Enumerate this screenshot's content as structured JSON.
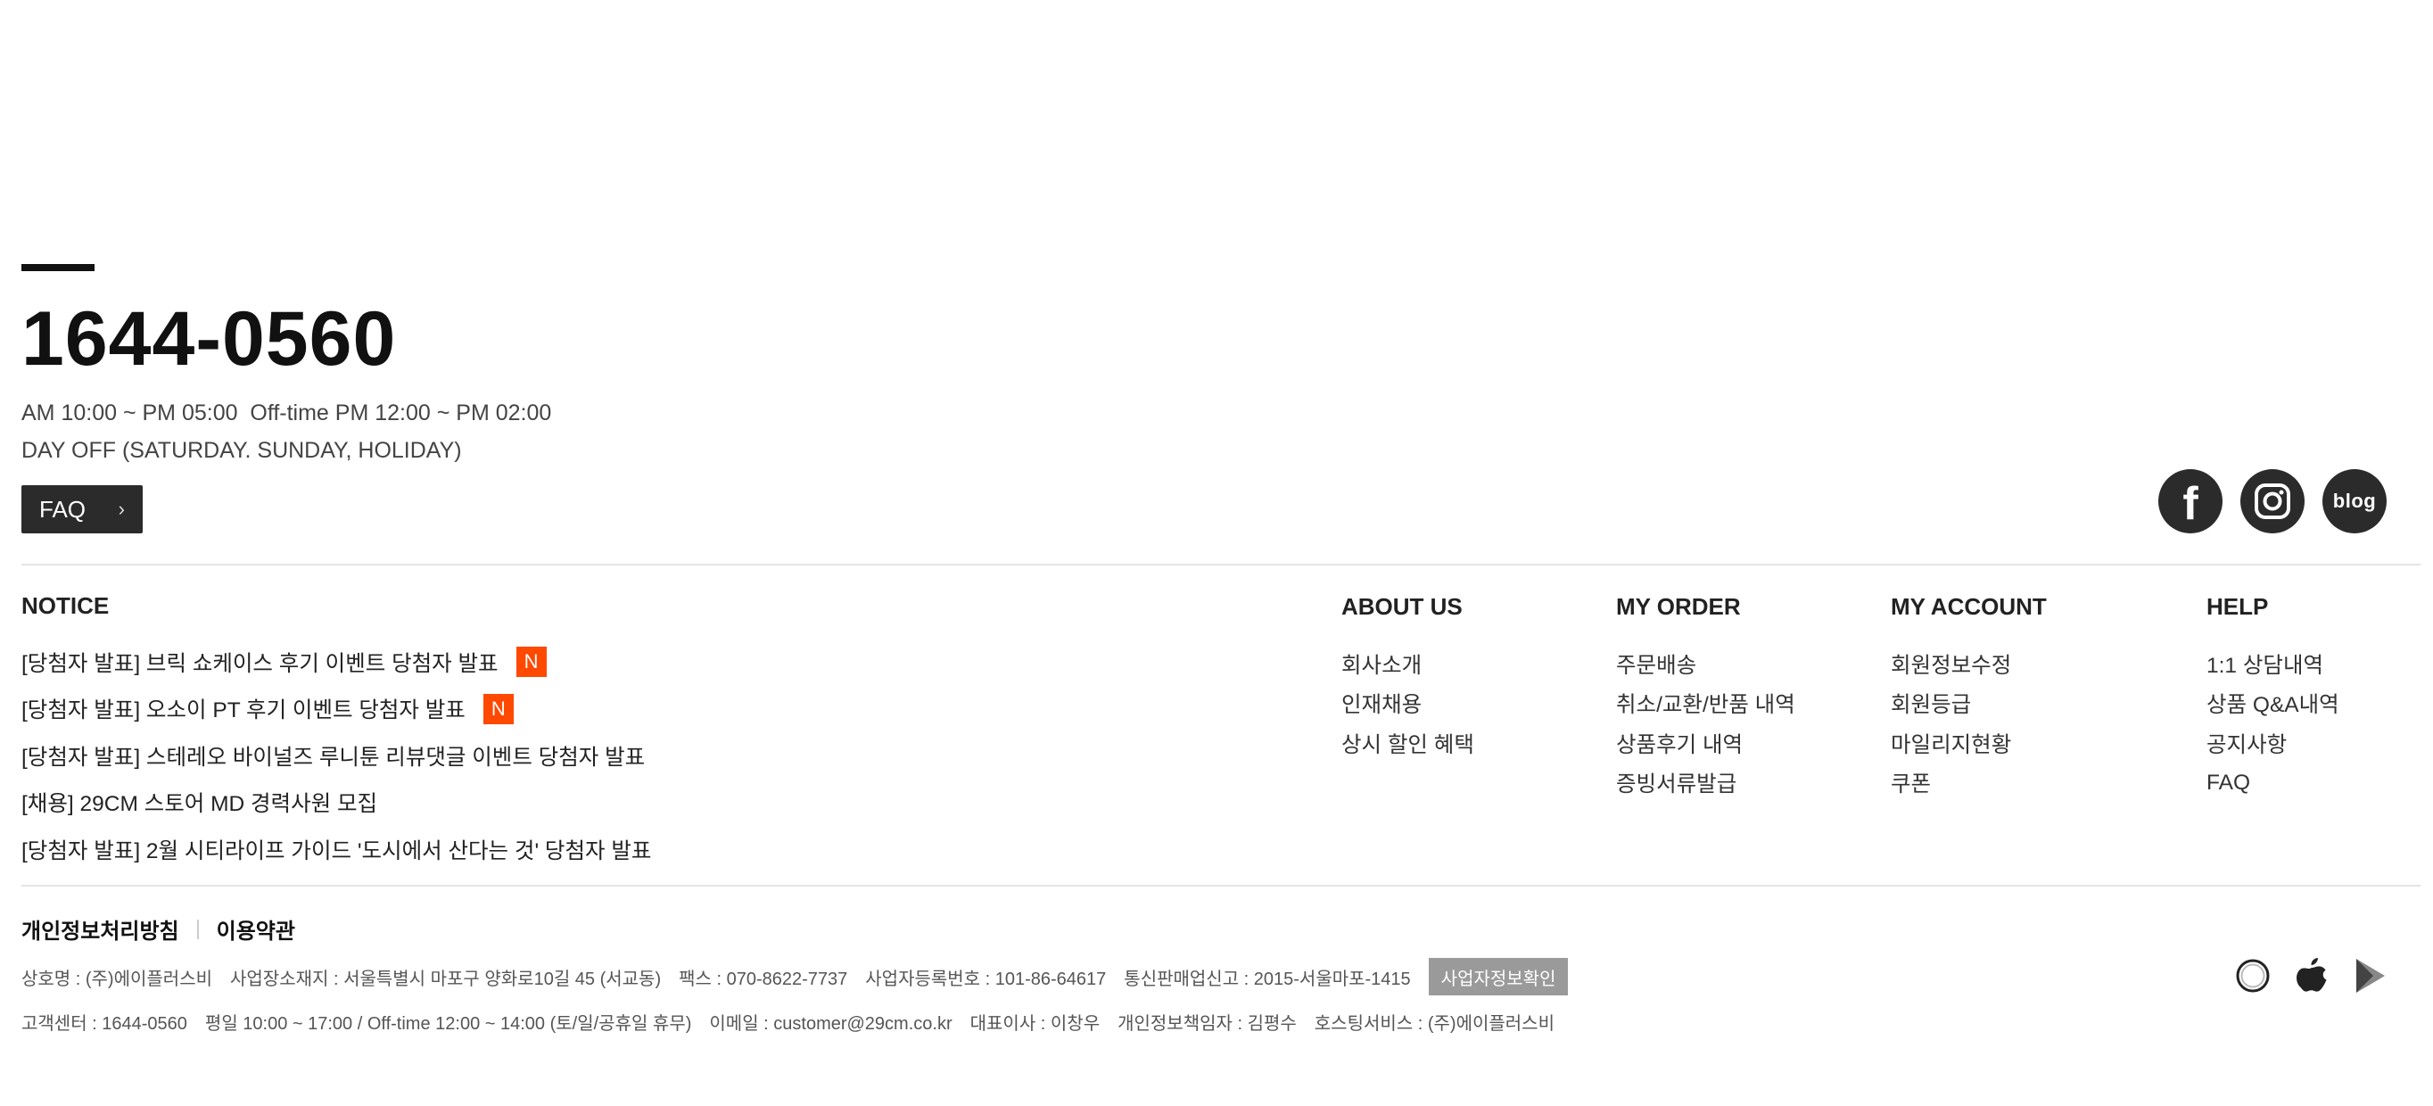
{
  "contact": {
    "phone": "1644-0560",
    "hours": "AM 10:00 ~ PM 05:00  Off-time PM 12:00 ~ PM 02:00",
    "dayoff": "DAY OFF (SATURDAY. SUNDAY, HOLIDAY)",
    "faq_label": "FAQ"
  },
  "social": {
    "facebook": "f",
    "blog": "blog",
    "icons": [
      "facebook-icon",
      "instagram-icon",
      "blog-icon"
    ]
  },
  "notice": {
    "title": "NOTICE",
    "items": [
      {
        "text": "[당첨자 발표] 브릭 쇼케이스 후기 이벤트 당첨자 발표",
        "badge": "N"
      },
      {
        "text": "[당첨자 발표] 오소이 PT 후기 이벤트 당첨자 발표",
        "badge": "N"
      },
      {
        "text": "[당첨자 발표] 스테레오 바이널즈 루니툰 리뷰댓글 이벤트 당첨자 발표",
        "badge": ""
      },
      {
        "text": "[채용] 29CM 스토어 MD 경력사원 모집",
        "badge": ""
      },
      {
        "text": "[당첨자 발표] 2월 시티라이프 가이드 '도시에서 산다는 것' 당첨자 발표",
        "badge": ""
      }
    ]
  },
  "about": {
    "title": "ABOUT US",
    "items": [
      "회사소개",
      "인재채용",
      "상시 할인 혜택"
    ]
  },
  "order": {
    "title": "MY ORDER",
    "items": [
      "주문배송",
      "취소/교환/반품 내역",
      "상품후기 내역",
      "증빙서류발급"
    ]
  },
  "account": {
    "title": "MY ACCOUNT",
    "items": [
      "회원정보수정",
      "회원등급",
      "마일리지현황",
      "쿠폰"
    ]
  },
  "help": {
    "title": "HELP",
    "items": [
      "1:1 상담내역",
      "상품 Q&A내역",
      "공지사항",
      "FAQ"
    ]
  },
  "footer": {
    "privacy": "개인정보처리방침",
    "terms": "이용약관",
    "company": "상호명 : (주)에이플러스비",
    "address": "사업장소재지 : 서울특별시 마포구 양화로10길 45 (서교동)",
    "fax": "팩스 : 070-8622-7737",
    "biz_no": "사업자등록번호 : 101-86-64617",
    "ecommerce": "통신판매업신고 : 2015-서울마포-1415",
    "biz_check": "사업자정보확인",
    "cs": "고객센터 : 1644-0560",
    "cs_hours": "평일 10:00 ~ 17:00 / Off-time 12:00 ~ 14:00 (토/일/공휴일 휴무)",
    "email": "이메일 : customer@29cm.co.kr",
    "ceo": "대표이사 : 이창우",
    "privacy_officer": "개인정보책임자 : 김평수",
    "hosting": "호스팅서비스 : (주)에이플러스비"
  },
  "colors": {
    "badge": "#ff4800",
    "dark": "#2b2b2b",
    "biz_button": "#9a9a9a"
  }
}
